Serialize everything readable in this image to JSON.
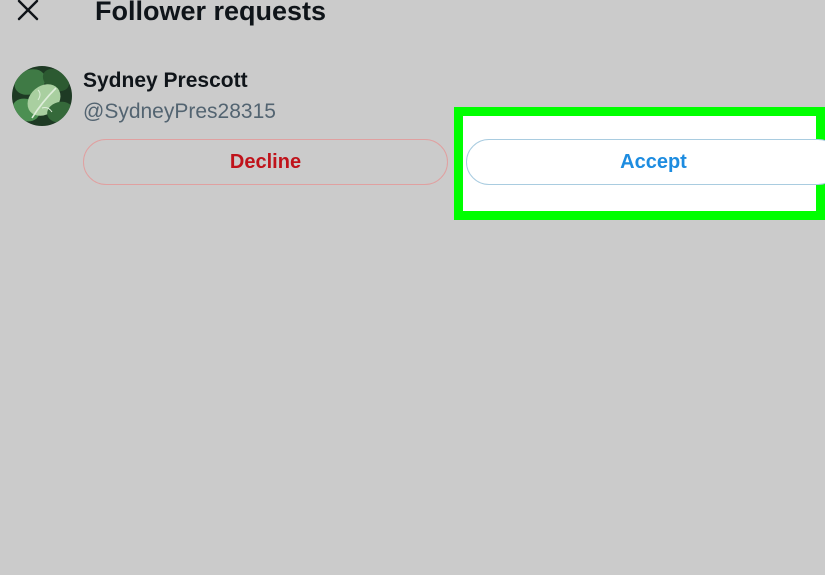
{
  "header": {
    "close_icon": "close-icon",
    "title": "Follower requests"
  },
  "request": {
    "display_name": "Sydney Prescott",
    "username": "@SydneyPres28315",
    "avatar": "leaf-avatar",
    "decline_label": "Decline",
    "accept_label": "Accept"
  },
  "colors": {
    "background": "#cbcbcb",
    "decline_text": "#c0131b",
    "accept_text": "#1d8ce0",
    "highlight": "#00ff00"
  }
}
